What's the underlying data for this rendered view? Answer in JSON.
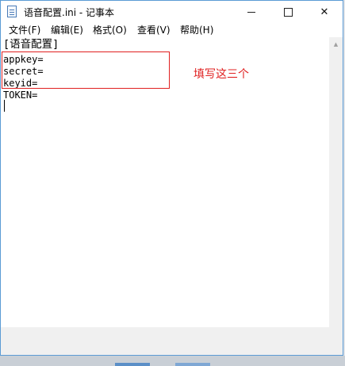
{
  "window": {
    "title": "语音配置.ini - 记事本",
    "minimize_glyph": "—",
    "close_glyph": "✕"
  },
  "menu": {
    "items": [
      {
        "label": "文件(F)"
      },
      {
        "label": "编辑(E)"
      },
      {
        "label": "格式(O)"
      },
      {
        "label": "查看(V)"
      },
      {
        "label": "帮助(H)"
      }
    ]
  },
  "editor": {
    "lines": [
      "[语音配置]",
      "appkey=",
      "secret=",
      "keyid=",
      "TOKEN="
    ]
  },
  "annotation": {
    "text": "填写这三个",
    "color": "#e02020"
  },
  "icons": {
    "app": "notepad-icon",
    "scroll_up": "chevron-up-icon"
  }
}
